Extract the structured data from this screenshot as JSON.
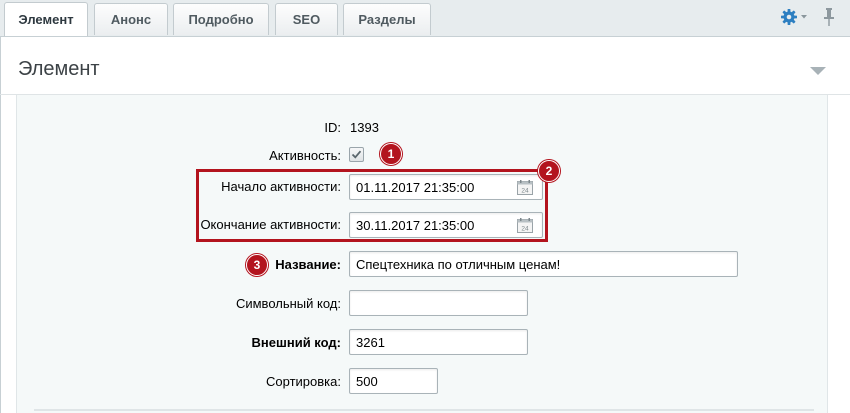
{
  "tabs": [
    {
      "label": "Элемент",
      "active": true
    },
    {
      "label": "Анонс",
      "active": false
    },
    {
      "label": "Подробно",
      "active": false
    },
    {
      "label": "SEO",
      "active": false
    },
    {
      "label": "Разделы",
      "active": false
    }
  ],
  "panel": {
    "title": "Элемент"
  },
  "form": {
    "id_label": "ID:",
    "id_value": "1393",
    "active_label": "Активность:",
    "active_checked": true,
    "active_from_label": "Начало активности:",
    "active_from_value": "01.11.2017 21:35:00",
    "active_to_label": "Окончание активности:",
    "active_to_value": "30.11.2017 21:35:00",
    "name_label": "Название:",
    "name_value": "Спецтехника по отличным ценам!",
    "code_label": "Символьный код:",
    "code_value": "",
    "xml_id_label": "Внешний код:",
    "xml_id_value": "3261",
    "sort_label": "Сортировка:",
    "sort_value": "500"
  },
  "annotations": {
    "badge_1": "1",
    "badge_2": "2",
    "badge_3": "3",
    "color": "#b3141e"
  },
  "icons": {
    "settings": "gear-icon",
    "pin": "pin-icon",
    "collapse": "triangle-down-icon",
    "calendar": "calendar-icon",
    "calendar_day": "24"
  }
}
